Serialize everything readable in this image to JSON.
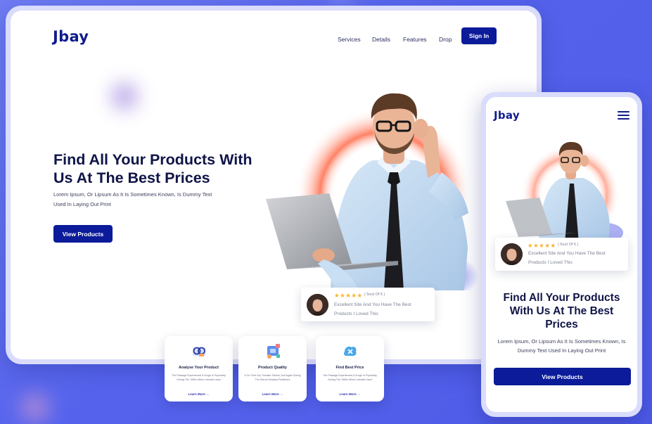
{
  "brand": {
    "logo": "Jbay"
  },
  "colors": {
    "primary": "#0b1b99",
    "background": "#5865ec",
    "star": "#f5b52a",
    "accent_ring": "#ff6b4a"
  },
  "desktop": {
    "nav": [
      "Services",
      "Details",
      "Features",
      "Drop"
    ],
    "signin_label": "Sign In",
    "hero": {
      "title": "Find All Your Products With Us At The Best Prices",
      "description": "Lorem Ipsum, Or Lipsum As It Is Sometimes Known, Is Dummy Text Used In Laying Out Print",
      "cta_label": "View Products"
    },
    "review": {
      "stars": "★★★★★",
      "score": "( 5out Of 5 )",
      "text": "Excellent Site And You Have The Best Products I Loved This"
    },
    "features": [
      {
        "icon": "analyse-icon",
        "title": "Analyse Your Product",
        "desc": "The Passage Experienced A Surge In Popularity During The 1960s When Letraset Used",
        "link": "Learn More →"
      },
      {
        "icon": "quality-icon",
        "title": "Product Quality",
        "desc": "It On Their Dry-Transfer Sheets, And Again During The 90s As Desktop Publishers",
        "link": "Learn More →"
      },
      {
        "icon": "price-icon",
        "title": "Find Best Price",
        "desc": "The Passage Experienced A Surge In Popularity During The 1960s When Letraset Used",
        "link": "Learn More →"
      }
    ]
  },
  "mobile": {
    "menu_icon": "hamburger-icon",
    "review": {
      "stars": "★★★★★",
      "score": "( 5out Of 5 )",
      "text": "Excellent Site And You Have The Best Products I Loved This"
    },
    "hero": {
      "title": "Find All Your Products With Us At The Best Prices",
      "description": "Lorem Ipsum, Or Lipsum As It Is Sometimes Known, Is Dummy Text Used In Laying Out Print",
      "cta_label": "View Products"
    }
  }
}
